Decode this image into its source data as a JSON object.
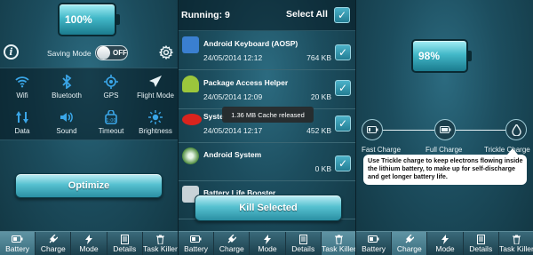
{
  "colors": {
    "accent": "#3aa6e8",
    "panel_bg": "#1c4d5e",
    "button": "#56c1d0"
  },
  "nav": [
    "Battery",
    "Charge",
    "Mode",
    "Details",
    "Task Killer"
  ],
  "panel1": {
    "battery_percent": "100%",
    "battery_level": 1.0,
    "saving_mode_label": "Saving Mode",
    "saving_mode_state": "OFF",
    "toggles": [
      {
        "label": "Wifi",
        "icon": "wifi-icon",
        "state": "on"
      },
      {
        "label": "Bluetooth",
        "icon": "bluetooth-icon",
        "state": "on"
      },
      {
        "label": "GPS",
        "icon": "gps-icon",
        "state": "on"
      },
      {
        "label": "Flight Mode",
        "icon": "airplane-icon",
        "state": "off"
      },
      {
        "label": "Data",
        "icon": "data-icon",
        "state": "on"
      },
      {
        "label": "Sound",
        "icon": "sound-icon",
        "state": "on"
      },
      {
        "label": "Timeout",
        "icon": "timeout-icon",
        "state": "on"
      },
      {
        "label": "Brightness",
        "icon": "brightness-icon",
        "state": "on"
      }
    ],
    "optimize_label": "Optimize"
  },
  "panel2": {
    "running_label": "Running: 9",
    "select_all_label": "Select All",
    "apps": [
      {
        "name": "Android Keyboard (AOSP)",
        "date": "24/05/2014 12:12",
        "size": "764 KB",
        "icon": "keyboard-icon"
      },
      {
        "name": "Package Access Helper",
        "date": "24/05/2014 12:09",
        "size": "20 KB",
        "icon": "android-icon"
      },
      {
        "name": "Syste",
        "date": "24/05/2014 12:17",
        "size": "452 KB",
        "icon": "red-app-icon"
      },
      {
        "name": "Android System",
        "date": "",
        "size": "0 KB",
        "icon": "system-icon"
      },
      {
        "name": "Battery Life Booster",
        "date": "",
        "size": "",
        "icon": "booster-icon"
      }
    ],
    "toast": "1.36 MB Cache released",
    "kill_label": "Kill Selected"
  },
  "panel3": {
    "battery_percent": "98%",
    "battery_level": 0.98,
    "stages": [
      "Fast Charge",
      "Full Charge",
      "Trickle Charge"
    ],
    "tooltip": "Use Trickle charge to keep electrons flowing inside the lithium battery, to make up for self-discharge and get longer battery life."
  }
}
